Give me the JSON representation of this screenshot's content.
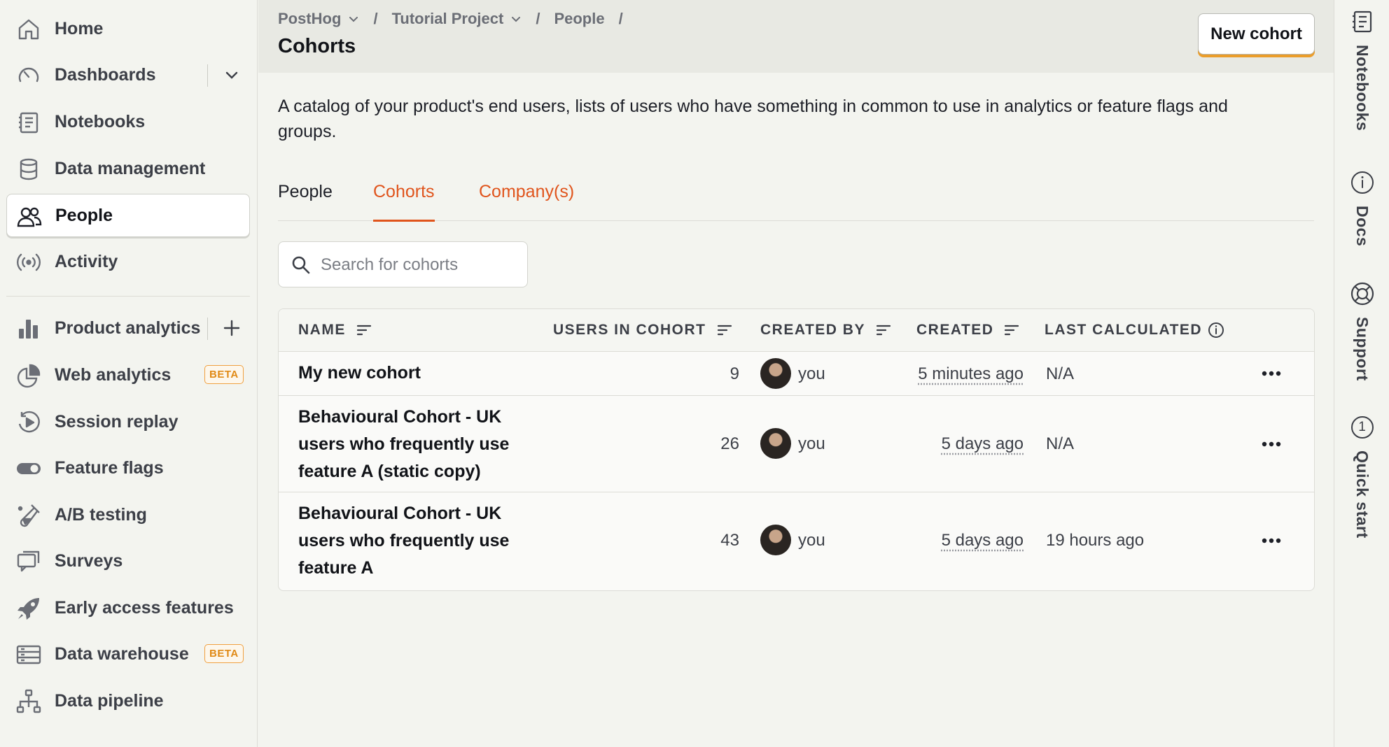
{
  "sidebar": {
    "items": [
      {
        "label": "Home",
        "icon": "home-icon"
      },
      {
        "label": "Dashboards",
        "icon": "dashboard-icon"
      },
      {
        "label": "Notebooks",
        "icon": "notebook-icon"
      },
      {
        "label": "Data management",
        "icon": "database-icon"
      },
      {
        "label": "People",
        "icon": "people-icon",
        "active": true
      },
      {
        "label": "Activity",
        "icon": "activity-icon"
      },
      {
        "label": "Product analytics",
        "icon": "bar-chart-icon"
      },
      {
        "label": "Web analytics",
        "icon": "pie-chart-icon",
        "badge": "BETA"
      },
      {
        "label": "Session replay",
        "icon": "replay-icon"
      },
      {
        "label": "Feature flags",
        "icon": "toggle-icon"
      },
      {
        "label": "A/B testing",
        "icon": "flask-icon"
      },
      {
        "label": "Surveys",
        "icon": "chat-icon"
      },
      {
        "label": "Early access features",
        "icon": "rocket-icon"
      },
      {
        "label": "Data warehouse",
        "icon": "warehouse-icon",
        "badge": "BETA"
      },
      {
        "label": "Data pipeline",
        "icon": "pipeline-icon"
      }
    ]
  },
  "header": {
    "breadcrumbs": [
      "PostHog",
      "Tutorial Project",
      "People"
    ],
    "separator": "/",
    "title": "Cohorts",
    "new_cohort_label": "New cohort"
  },
  "main": {
    "description": "A catalog of your product's end users, lists of users who have something in common to use in analytics or feature flags and groups.",
    "tabs": [
      {
        "label": "People"
      },
      {
        "label": "Cohorts",
        "active": true
      },
      {
        "label": "Company(s)"
      }
    ],
    "search": {
      "placeholder": "Search for cohorts",
      "value": ""
    }
  },
  "table": {
    "columns": [
      "NAME",
      "USERS IN COHORT",
      "CREATED BY",
      "CREATED",
      "LAST CALCULATED"
    ],
    "rows": [
      {
        "name": "My new cohort",
        "users": "9",
        "created_by": "you",
        "created": "5 minutes ago",
        "last_calculated": "N/A"
      },
      {
        "name": "Behavioural Cohort - UK users who frequently use feature A (static copy)",
        "users": "26",
        "created_by": "you",
        "created": "5 days ago",
        "last_calculated": "N/A"
      },
      {
        "name": "Behavioural Cohort - UK users who frequently use feature A",
        "users": "43",
        "created_by": "you",
        "created": "5 days ago",
        "last_calculated": "19 hours ago"
      }
    ]
  },
  "rail": {
    "items": [
      {
        "label": "Notebooks",
        "icon": "notebook-icon"
      },
      {
        "label": "Docs",
        "icon": "info-icon"
      },
      {
        "label": "Support",
        "icon": "lifebuoy-icon"
      },
      {
        "label": "Quick start",
        "icon": "step-icon",
        "number": "1"
      }
    ]
  },
  "colors": {
    "accent": "#e0541c",
    "button_shadow": "#eb9d2a",
    "badge": "#e08a16"
  }
}
